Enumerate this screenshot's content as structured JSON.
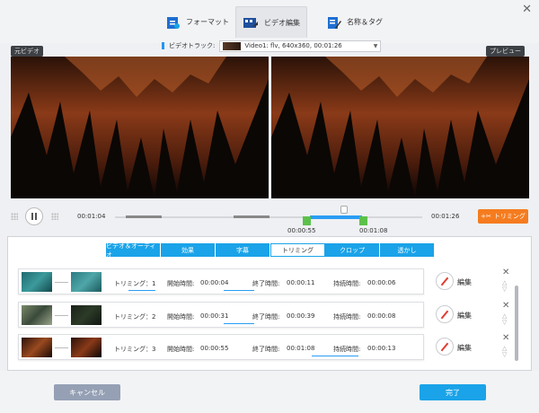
{
  "tabs": [
    {
      "label": "フォーマット"
    },
    {
      "label": "ビデオ編集"
    },
    {
      "label": "名称＆タグ"
    }
  ],
  "track": {
    "label": "ビデオトラック:",
    "value": "Video1: flv, 640x360, 00:01:26"
  },
  "labels": {
    "original": "元ビデオ",
    "preview": "プレビュー"
  },
  "playback": {
    "current": "00:01:04",
    "total": "00:01:26",
    "start": "00:00:55",
    "end": "00:01:08",
    "trim_button": "トリミング"
  },
  "edit_tabs": [
    {
      "label": "ビデオ＆オーディオ"
    },
    {
      "label": "効果"
    },
    {
      "label": "字幕"
    },
    {
      "label": "トリミング"
    },
    {
      "label": "クロップ"
    },
    {
      "label": "透かし"
    }
  ],
  "rows": [
    {
      "trim": "トリミング：1",
      "start_label": "開始時間:",
      "start": "00:00:04",
      "end_label": "終了時間:",
      "end": "00:00:11",
      "dur_label": "持続時間:",
      "dur": "00:00:06",
      "edit": "編集"
    },
    {
      "trim": "トリミング：2",
      "start_label": "開始時間:",
      "start": "00:00:31",
      "end_label": "終了時間:",
      "end": "00:00:39",
      "dur_label": "持続時間:",
      "dur": "00:00:08",
      "edit": "編集"
    },
    {
      "trim": "トリミング：3",
      "start_label": "開始時間:",
      "start": "00:00:55",
      "end_label": "終了時間:",
      "end": "00:01:08",
      "dur_label": "持続時間:",
      "dur": "00:00:13",
      "edit": "編集"
    }
  ],
  "footer": {
    "cancel": "キャンセル",
    "done": "完了"
  },
  "colors": {
    "accent": "#1aa3e8",
    "trim": "#f57c1f",
    "handle": "#5cc14a"
  }
}
